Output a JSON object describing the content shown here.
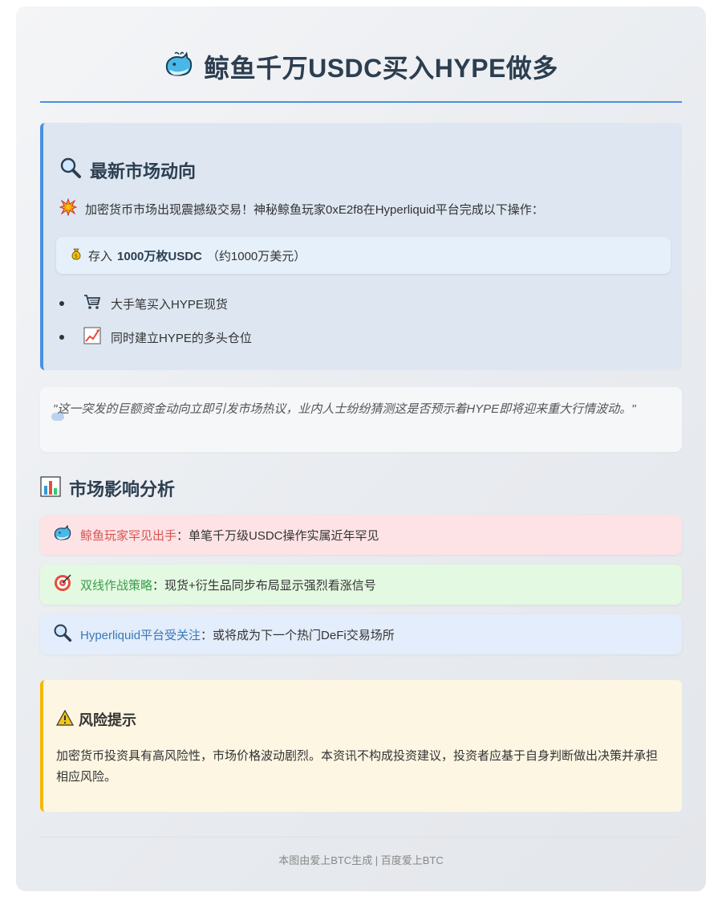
{
  "header": {
    "title": "鲸鱼千万USDC买入HYPE做多",
    "icon": "whale-icon"
  },
  "news": {
    "heading": "最新市场动向",
    "heading_icon": "magnifier-icon",
    "intro_icon": "explosion-icon",
    "intro": "加密货币市场出现震撼级交易！神秘鲸鱼玩家0xE2f8在Hyperliquid平台完成以下操作：",
    "deposit": {
      "icon": "money-bag-icon",
      "prefix": "存入",
      "amount": "1000万枚USDC",
      "suffix": "（约1000万美元）"
    },
    "bullets": [
      {
        "icon": "shopping-cart-icon",
        "text": "大手笔买入HYPE现货"
      },
      {
        "icon": "chart-up-icon",
        "text": "同时建立HYPE的多头仓位"
      }
    ]
  },
  "quote": {
    "text": "\"这一突发的巨额资金动向立即引发市场热议，业内人士纷纷猜测这是否预示着HYPE即将迎来重大行情波动。\""
  },
  "analysis": {
    "heading": "市场影响分析",
    "heading_icon": "bar-chart-icon",
    "items": [
      {
        "icon": "whale-icon",
        "highlight": "鲸鱼玩家罕见出手",
        "text": "：单笔千万级USDC操作实属近年罕见",
        "color": "#d9534f"
      },
      {
        "icon": "target-icon",
        "highlight": "双线作战策略",
        "text": "：现货+衍生品同步布局显示强烈看涨信号",
        "color": "#3a9d4a"
      },
      {
        "icon": "magnifier-icon",
        "highlight": "Hyperliquid平台受关注",
        "text": "：或将成为下一个热门DeFi交易场所",
        "color": "#3a78b8"
      }
    ]
  },
  "risk": {
    "icon": "warning-icon",
    "heading": "风险提示",
    "text": "加密货币投资具有高风险性，市场价格波动剧烈。本资讯不构成投资建议，投资者应基于自身判断做出决策并承担相应风险。"
  },
  "footer": {
    "text": "本图由爱上BTC生成 | 百度爱上BTC"
  },
  "colors": {
    "accent": "#4a90e2",
    "warning": "#f5b800",
    "title": "#2c3e50"
  }
}
